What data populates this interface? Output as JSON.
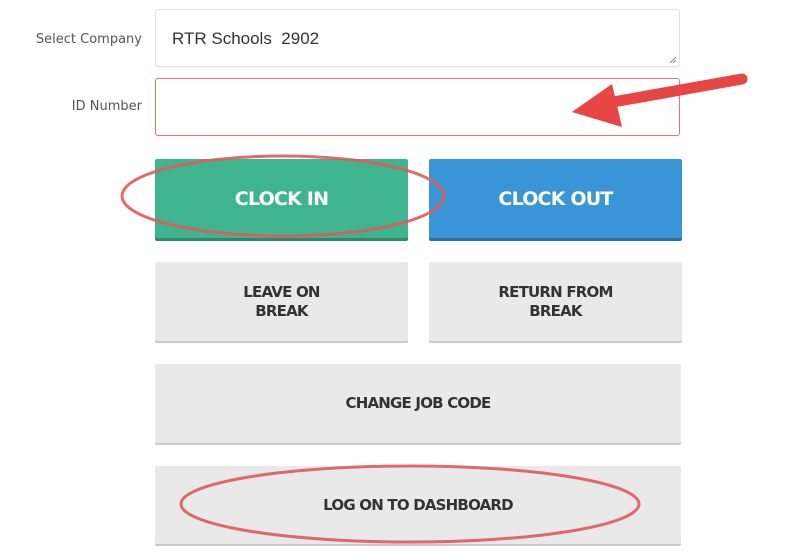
{
  "form": {
    "company_label": "Select Company",
    "company_value": "RTR Schools  2902",
    "id_label": "ID Number",
    "id_value": ""
  },
  "buttons": {
    "clock_in": "CLOCK IN",
    "clock_out": "CLOCK OUT",
    "leave_break_line1": "LEAVE ON",
    "leave_break_line2": "BREAK",
    "return_break_line1": "RETURN FROM",
    "return_break_line2": "BREAK",
    "change_job_code": "CHANGE JOB CODE",
    "log_on_dashboard": "LOG ON TO DASHBOARD"
  },
  "colors": {
    "clock_in_bg": "#3fb58f",
    "clock_out_bg": "#3a95d6",
    "secondary_bg": "#e8e9e8",
    "error_border": "#e8746f",
    "annotation": "#e05a5a"
  }
}
